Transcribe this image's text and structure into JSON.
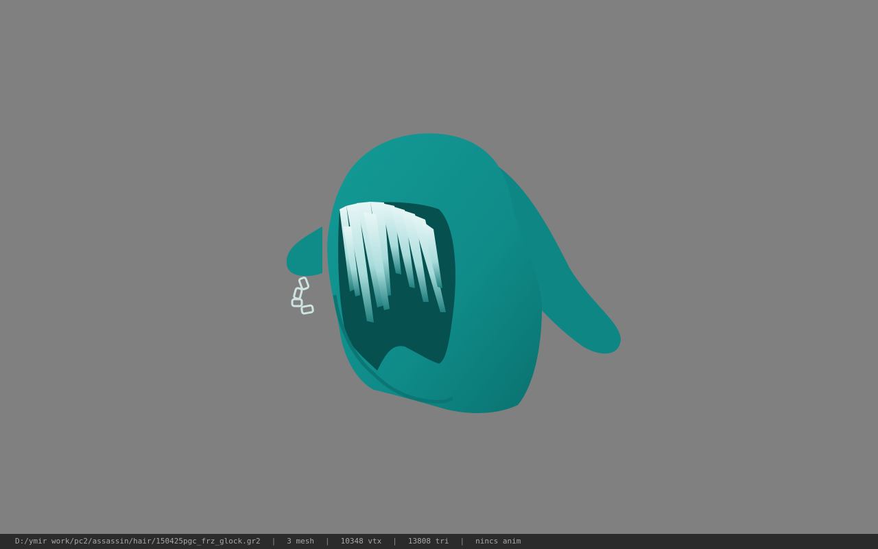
{
  "viewport": {
    "background_color": "#808080",
    "model_label": "hooded hair mesh",
    "hood_color": "#0f8b88",
    "hood_shadow_color": "#06504f",
    "hair_color": "#bfe6e6",
    "chain_color": "#cfe3e3"
  },
  "status": {
    "file_path": "D:/ymir work/pc2/assassin/hair/150425pgc_frz_glock.gr2",
    "separator": "|",
    "mesh_count": "3 mesh",
    "vertex_count": "10348 vtx",
    "triangle_count": "13808 tri",
    "anim_status": "nincs anim",
    "background_color": "#2b2b2b",
    "text_color": "#a8a8a8"
  }
}
